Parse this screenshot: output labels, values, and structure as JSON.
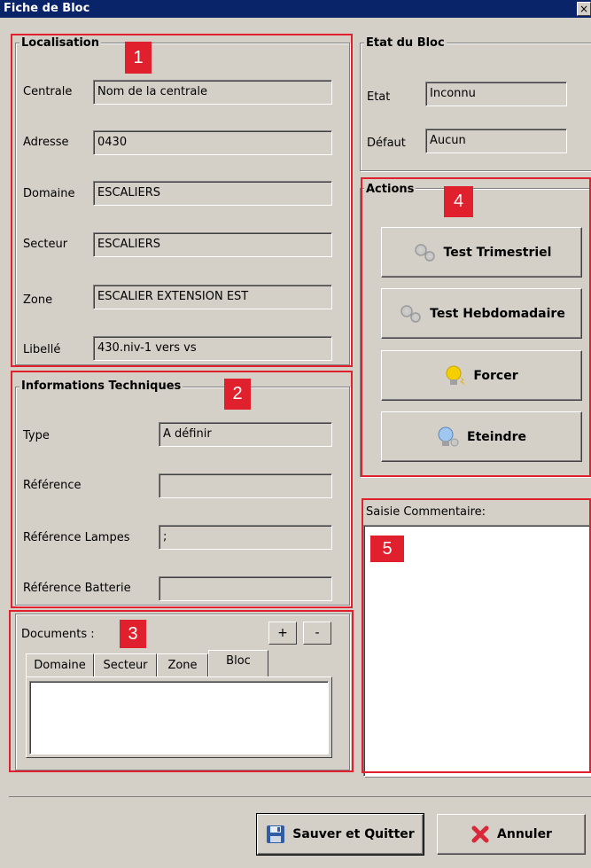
{
  "window": {
    "title": "Fiche de Bloc",
    "close_glyph": "×"
  },
  "localisation": {
    "title": "Localisation",
    "fields": [
      {
        "label": "Centrale",
        "value": "Nom de la centrale"
      },
      {
        "label": "Adresse",
        "value": "0430"
      },
      {
        "label": "Domaine",
        "value": "ESCALIERS"
      },
      {
        "label": "Secteur",
        "value": "ESCALIERS"
      },
      {
        "label": "Zone",
        "value": "ESCALIER EXTENSION EST"
      },
      {
        "label": "Libellé",
        "value": "430.niv-1 vers vs"
      }
    ]
  },
  "etat_bloc": {
    "title": "Etat du Bloc",
    "fields": [
      {
        "label": "Etat",
        "value": "Inconnu"
      },
      {
        "label": "Défaut",
        "value": "Aucun"
      }
    ]
  },
  "infos_tech": {
    "title": "Informations Techniques",
    "fields": [
      {
        "label": "Type",
        "value": "A définir"
      },
      {
        "label": "Référence",
        "value": ""
      },
      {
        "label": "Référence Lampes",
        "value": ";"
      },
      {
        "label": "Référence Batterie",
        "value": ""
      }
    ]
  },
  "actions": {
    "title": "Actions",
    "buttons": [
      {
        "label": "Test Trimestriel",
        "icon": "gears-icon"
      },
      {
        "label": "Test Hebdomadaire",
        "icon": "gears-icon"
      },
      {
        "label": "Forcer",
        "icon": "lightbulb-on-icon"
      },
      {
        "label": "Eteindre",
        "icon": "lightbulb-off-icon"
      }
    ]
  },
  "documents": {
    "label": "Documents :",
    "add": "+",
    "remove": "-",
    "tabs": [
      "Domaine",
      "Secteur",
      "Zone",
      "Bloc"
    ],
    "active_tab": "Bloc"
  },
  "comment": {
    "label": "Saisie Commentaire:",
    "value": ""
  },
  "footer": {
    "save": "Sauver et Quitter",
    "cancel": "Annuler"
  },
  "annotations": [
    "1",
    "2",
    "3",
    "4",
    "5"
  ],
  "colors": {
    "titlebar": "#0a246a",
    "annotation": "#e0202c",
    "window": "#d4d0c8"
  }
}
